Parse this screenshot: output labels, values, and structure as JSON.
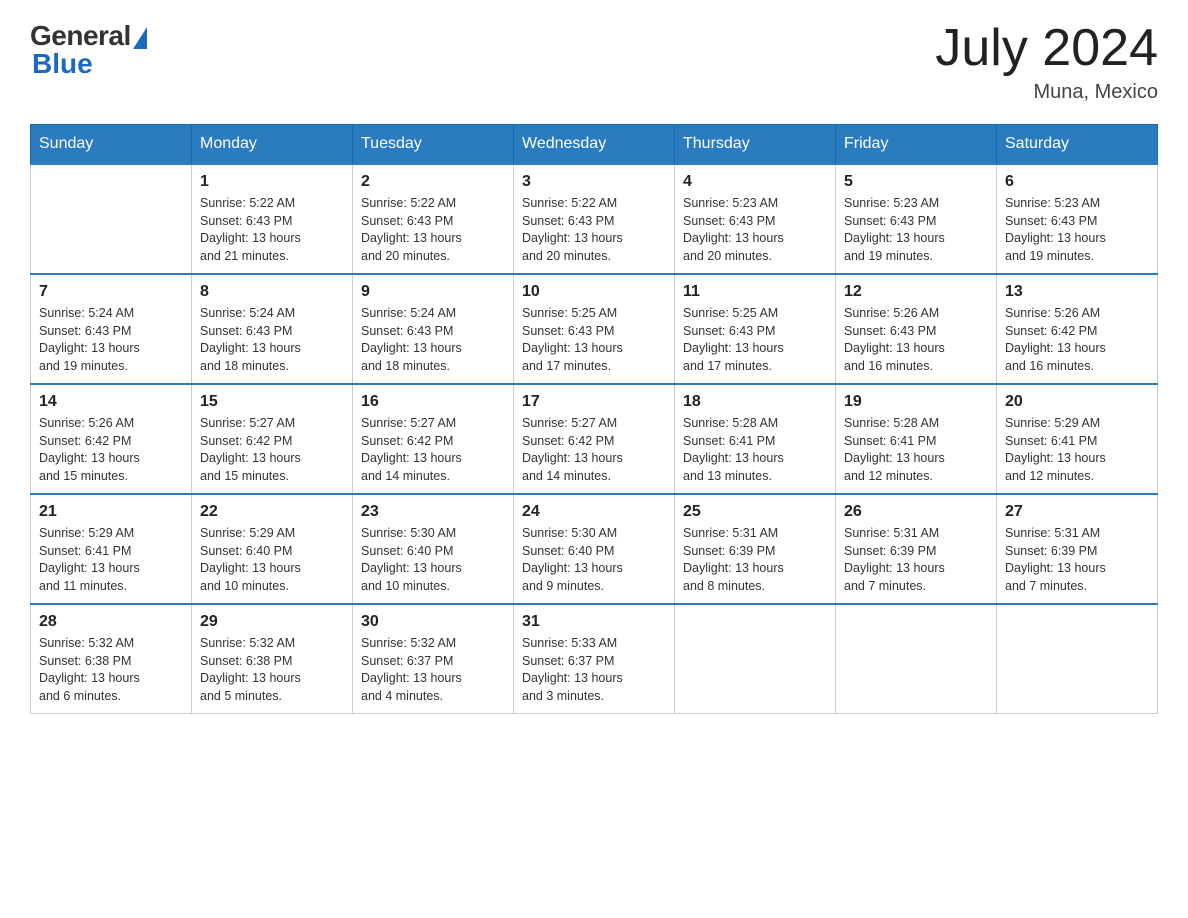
{
  "header": {
    "logo_general": "General",
    "logo_blue": "Blue",
    "month_year": "July 2024",
    "location": "Muna, Mexico"
  },
  "days_of_week": [
    "Sunday",
    "Monday",
    "Tuesday",
    "Wednesday",
    "Thursday",
    "Friday",
    "Saturday"
  ],
  "weeks": [
    [
      {
        "day": "",
        "info": ""
      },
      {
        "day": "1",
        "info": "Sunrise: 5:22 AM\nSunset: 6:43 PM\nDaylight: 13 hours\nand 21 minutes."
      },
      {
        "day": "2",
        "info": "Sunrise: 5:22 AM\nSunset: 6:43 PM\nDaylight: 13 hours\nand 20 minutes."
      },
      {
        "day": "3",
        "info": "Sunrise: 5:22 AM\nSunset: 6:43 PM\nDaylight: 13 hours\nand 20 minutes."
      },
      {
        "day": "4",
        "info": "Sunrise: 5:23 AM\nSunset: 6:43 PM\nDaylight: 13 hours\nand 20 minutes."
      },
      {
        "day": "5",
        "info": "Sunrise: 5:23 AM\nSunset: 6:43 PM\nDaylight: 13 hours\nand 19 minutes."
      },
      {
        "day": "6",
        "info": "Sunrise: 5:23 AM\nSunset: 6:43 PM\nDaylight: 13 hours\nand 19 minutes."
      }
    ],
    [
      {
        "day": "7",
        "info": "Sunrise: 5:24 AM\nSunset: 6:43 PM\nDaylight: 13 hours\nand 19 minutes."
      },
      {
        "day": "8",
        "info": "Sunrise: 5:24 AM\nSunset: 6:43 PM\nDaylight: 13 hours\nand 18 minutes."
      },
      {
        "day": "9",
        "info": "Sunrise: 5:24 AM\nSunset: 6:43 PM\nDaylight: 13 hours\nand 18 minutes."
      },
      {
        "day": "10",
        "info": "Sunrise: 5:25 AM\nSunset: 6:43 PM\nDaylight: 13 hours\nand 17 minutes."
      },
      {
        "day": "11",
        "info": "Sunrise: 5:25 AM\nSunset: 6:43 PM\nDaylight: 13 hours\nand 17 minutes."
      },
      {
        "day": "12",
        "info": "Sunrise: 5:26 AM\nSunset: 6:43 PM\nDaylight: 13 hours\nand 16 minutes."
      },
      {
        "day": "13",
        "info": "Sunrise: 5:26 AM\nSunset: 6:42 PM\nDaylight: 13 hours\nand 16 minutes."
      }
    ],
    [
      {
        "day": "14",
        "info": "Sunrise: 5:26 AM\nSunset: 6:42 PM\nDaylight: 13 hours\nand 15 minutes."
      },
      {
        "day": "15",
        "info": "Sunrise: 5:27 AM\nSunset: 6:42 PM\nDaylight: 13 hours\nand 15 minutes."
      },
      {
        "day": "16",
        "info": "Sunrise: 5:27 AM\nSunset: 6:42 PM\nDaylight: 13 hours\nand 14 minutes."
      },
      {
        "day": "17",
        "info": "Sunrise: 5:27 AM\nSunset: 6:42 PM\nDaylight: 13 hours\nand 14 minutes."
      },
      {
        "day": "18",
        "info": "Sunrise: 5:28 AM\nSunset: 6:41 PM\nDaylight: 13 hours\nand 13 minutes."
      },
      {
        "day": "19",
        "info": "Sunrise: 5:28 AM\nSunset: 6:41 PM\nDaylight: 13 hours\nand 12 minutes."
      },
      {
        "day": "20",
        "info": "Sunrise: 5:29 AM\nSunset: 6:41 PM\nDaylight: 13 hours\nand 12 minutes."
      }
    ],
    [
      {
        "day": "21",
        "info": "Sunrise: 5:29 AM\nSunset: 6:41 PM\nDaylight: 13 hours\nand 11 minutes."
      },
      {
        "day": "22",
        "info": "Sunrise: 5:29 AM\nSunset: 6:40 PM\nDaylight: 13 hours\nand 10 minutes."
      },
      {
        "day": "23",
        "info": "Sunrise: 5:30 AM\nSunset: 6:40 PM\nDaylight: 13 hours\nand 10 minutes."
      },
      {
        "day": "24",
        "info": "Sunrise: 5:30 AM\nSunset: 6:40 PM\nDaylight: 13 hours\nand 9 minutes."
      },
      {
        "day": "25",
        "info": "Sunrise: 5:31 AM\nSunset: 6:39 PM\nDaylight: 13 hours\nand 8 minutes."
      },
      {
        "day": "26",
        "info": "Sunrise: 5:31 AM\nSunset: 6:39 PM\nDaylight: 13 hours\nand 7 minutes."
      },
      {
        "day": "27",
        "info": "Sunrise: 5:31 AM\nSunset: 6:39 PM\nDaylight: 13 hours\nand 7 minutes."
      }
    ],
    [
      {
        "day": "28",
        "info": "Sunrise: 5:32 AM\nSunset: 6:38 PM\nDaylight: 13 hours\nand 6 minutes."
      },
      {
        "day": "29",
        "info": "Sunrise: 5:32 AM\nSunset: 6:38 PM\nDaylight: 13 hours\nand 5 minutes."
      },
      {
        "day": "30",
        "info": "Sunrise: 5:32 AM\nSunset: 6:37 PM\nDaylight: 13 hours\nand 4 minutes."
      },
      {
        "day": "31",
        "info": "Sunrise: 5:33 AM\nSunset: 6:37 PM\nDaylight: 13 hours\nand 3 minutes."
      },
      {
        "day": "",
        "info": ""
      },
      {
        "day": "",
        "info": ""
      },
      {
        "day": "",
        "info": ""
      }
    ]
  ]
}
